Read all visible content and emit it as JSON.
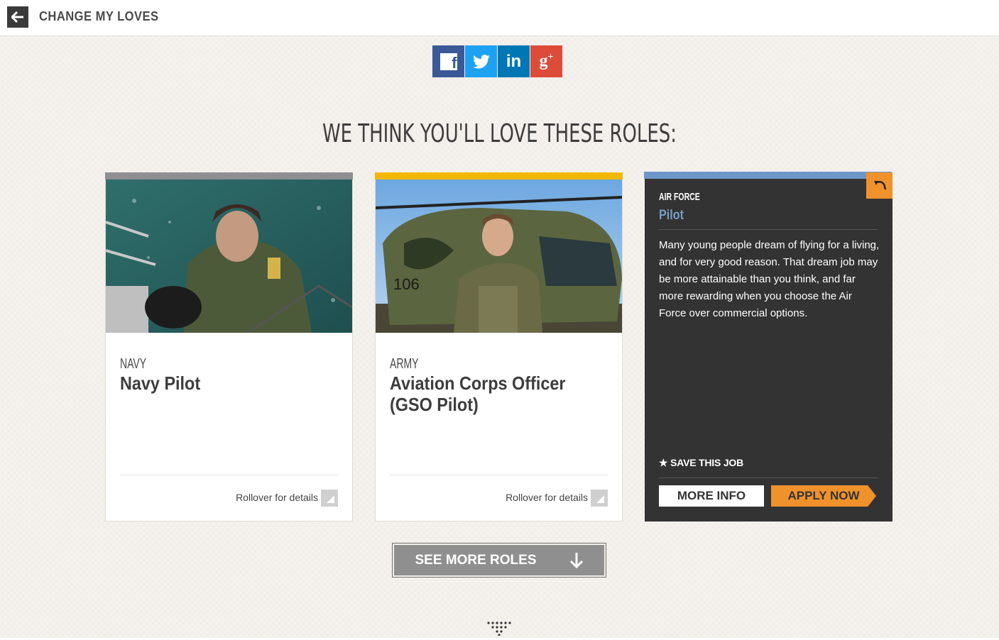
{
  "header": {
    "title": "CHANGE MY LOVES",
    "back_icon": "arrow-left-icon"
  },
  "social": [
    {
      "name": "facebook",
      "label": "f",
      "color": "#3b5998"
    },
    {
      "name": "twitter",
      "label": "",
      "color": "#1da1f2"
    },
    {
      "name": "linkedin",
      "label": "in",
      "color": "#0077b5"
    },
    {
      "name": "google-plus",
      "label": "g+",
      "color": "#dd4b39"
    }
  ],
  "main": {
    "heading": "WE THINK YOU'LL LOVE THESE ROLES:"
  },
  "cards": [
    {
      "branch": "NAVY",
      "role": "Navy Pilot",
      "rollover": "Rollover for details",
      "stripe_color": "#8e8e93"
    },
    {
      "branch": "ARMY",
      "role": "Aviation Corps Officer (GSO Pilot)",
      "rollover": "Rollover for details",
      "stripe_color": "#f2b705"
    },
    {
      "branch": "AIR FORCE",
      "role": "Pilot",
      "description": "Many young people dream of flying for a living, and for very good reason. That dream job may be more attainable than you think, and far more rewarding when you choose the Air Force over commercial options.",
      "save_label": "SAVE THIS JOB",
      "more_info": "MORE INFO",
      "apply_now": "APPLY NOW",
      "stripe_color": "#6d97c9"
    }
  ],
  "footer": {
    "see_more": "SEE MORE ROLES"
  }
}
